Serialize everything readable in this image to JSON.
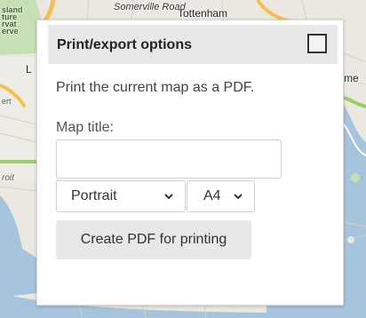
{
  "map": {
    "labels": {
      "island": "sland\nture\nrvat\nerve",
      "road": "Somerville Road",
      "tottenham": "Tottenham",
      "erme": "rme",
      "ert": "ert",
      "roit": "roit",
      "l": "L"
    }
  },
  "panel": {
    "title": "Print/export options",
    "description": "Print the current map as a PDF.",
    "map_title_label": "Map title:",
    "map_title_value": "",
    "orientation": {
      "selected": "Portrait"
    },
    "paper_size": {
      "selected": "A4"
    },
    "create_button_label": "Create PDF for printing"
  },
  "colors": {
    "header_bg": "#e8e8e8",
    "button_bg": "#e8e8e8",
    "water": "#a7c4dd",
    "park": "#c7dfb4",
    "road_major": "#f5c04a",
    "road_green": "#9ccf61"
  },
  "icons": {
    "close": "checkbox-square-icon",
    "dropdown": "chevron-down-icon"
  }
}
